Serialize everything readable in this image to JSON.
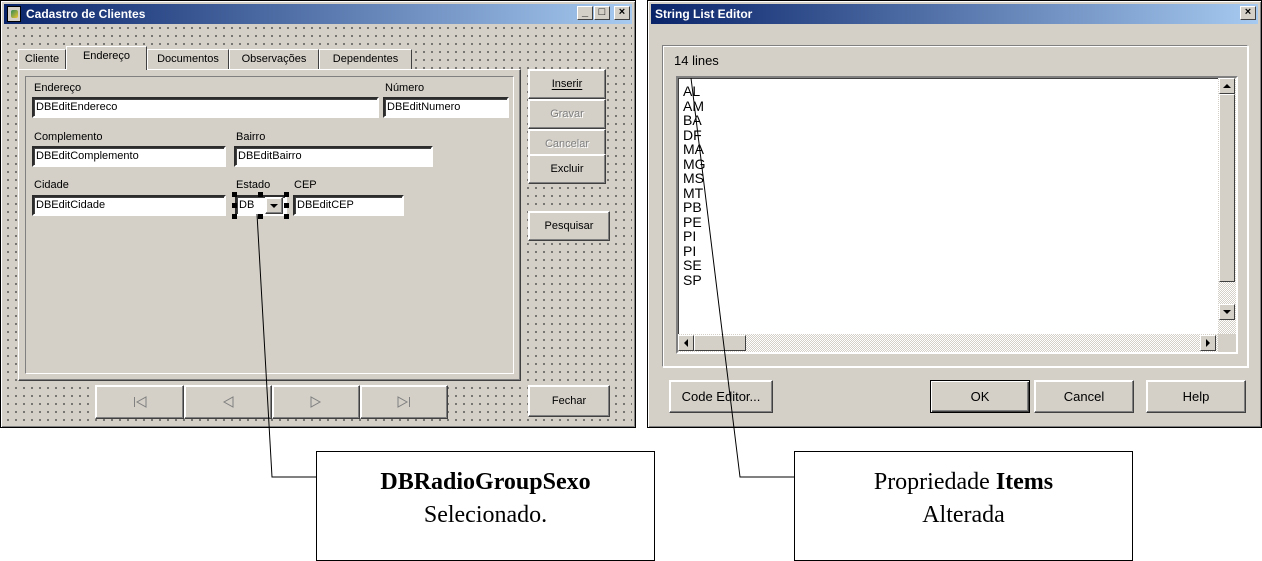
{
  "left_window": {
    "title": "Cadastro de Clientes",
    "tabs": [
      "Cliente",
      "Endereço",
      "Documentos",
      "Observações",
      "Dependentes"
    ],
    "active_tab": "Endereço",
    "fields": {
      "endereco": {
        "label": "Endereço",
        "value": "DBEditEndereco"
      },
      "numero": {
        "label": "Número",
        "value": "DBEditNumero"
      },
      "complemento": {
        "label": "Complemento",
        "value": "DBEditComplemento"
      },
      "bairro": {
        "label": "Bairro",
        "value": "DBEditBairro"
      },
      "cidade": {
        "label": "Cidade",
        "value": "DBEditCidade"
      },
      "estado": {
        "label": "Estado",
        "value": "DB"
      },
      "cep": {
        "label": "CEP",
        "value": "DBEditCEP"
      }
    },
    "buttons": {
      "inserir": "Inserir",
      "gravar": "Gravar",
      "cancelar": "Cancelar",
      "excluir": "Excluir",
      "pesquisar": "Pesquisar",
      "fechar": "Fechar"
    },
    "navigator": [
      "first",
      "prior",
      "next",
      "last"
    ]
  },
  "right_window": {
    "title": "String List Editor",
    "line_count": "14 lines",
    "lines": [
      "AL",
      "AM",
      "BA",
      "DF",
      "MA",
      "MG",
      "MS",
      "MT",
      "PB",
      "PE",
      "PI",
      "PI",
      "SE",
      "SP"
    ],
    "buttons": {
      "code_editor": "Code Editor...",
      "ok": "OK",
      "cancel": "Cancel",
      "help": "Help"
    }
  },
  "callouts": {
    "left": {
      "bold": "DBRadioGroupSexo",
      "text": "Selecionado."
    },
    "right": {
      "prefix": "Propriedade ",
      "bold": "Items",
      "text": "Alterada"
    }
  },
  "colors": {
    "titlebar_start": "#0a246a",
    "titlebar_end": "#a6caf0",
    "face": "#d4d0c8"
  }
}
